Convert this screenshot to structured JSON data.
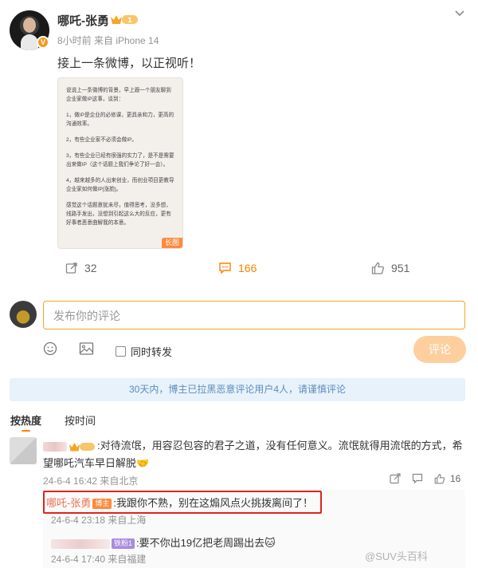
{
  "post": {
    "author": "哪吒-张勇",
    "vip_level": "1",
    "meta": "8小时前  来自 iPhone 14",
    "text": "接上一条微博，以正视听！",
    "long_image": {
      "paragraphs": [
        "说说上一条微博的背景，早上跟一个朋友聊到企业家做IP这事，谈到：",
        "1，做IP是企业的必修课，更具亲和力，更高的沟通效率。",
        "2，有些企业家不必须会做IP。",
        "3，有些企业已经有很强的实力了，是不是需要出来做IP（这个话题上我们争论了好一会）。",
        "4，越来越多的人出来创业，而创业项目更教导企业家如何做IP[涨脸]。",
        "感觉这个话题意犹未尽，值得思考，没多想，线路手发出，没想到引起这么大的反应，更有好事者恶意曲解我的本意。"
      ],
      "tag": "长图"
    },
    "repost_count": "32",
    "comment_count": "166",
    "like_count": "951"
  },
  "compose": {
    "placeholder": "发布你的评论",
    "repost_label": "同时转发",
    "submit_label": "评论"
  },
  "notice": "30天内，博主已拉黑恶意评论用户4人，请谨慎评论",
  "sort": {
    "hot": "按热度",
    "time": "按时间"
  },
  "comments": [
    {
      "text": ":对待流氓，用容忍包容的君子之道，没有任何意义。流氓就得用流氓的方式，希望哪吒汽车早日解脱🤝",
      "meta": "24-6-4 16:42  来自北京",
      "like_count": "16",
      "replies": [
        {
          "name": "哪吒-张勇",
          "tag": "博主",
          "text": ":我跟你不熟，别在这煽风点火挑拨离间了！",
          "meta": "24-6-4 23:18  来自上海"
        },
        {
          "tag": "铁粉1",
          "text": ":要不你出19亿把老周踢出去🐱",
          "meta": "24-6-4 17:40  来自福建"
        }
      ]
    }
  ],
  "watermark": "@SUV头百科",
  "colors": {
    "accent": "#ff8200",
    "input_border": "#f5a623",
    "name_link": "#eb7350",
    "highlight_box": "#e0231e",
    "notice_bg": "#e8f2fb"
  }
}
